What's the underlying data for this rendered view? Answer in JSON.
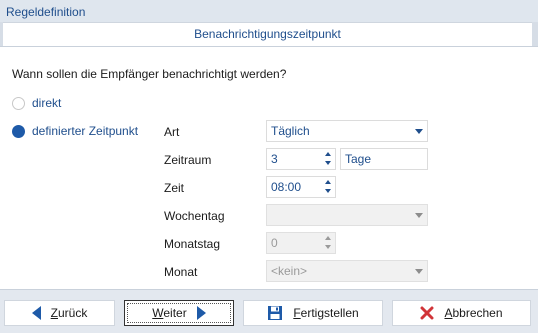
{
  "window": {
    "title": "Regeldefinition"
  },
  "tab": {
    "label": "Benachrichtigungszeitpunkt"
  },
  "question": "Wann sollen die Empfänger benachrichtigt werden?",
  "options": [
    {
      "label": "direkt",
      "checked": false
    },
    {
      "label": "definierter Zeitpunkt",
      "checked": true
    }
  ],
  "fields": {
    "art": {
      "label": "Art",
      "value": "Täglich"
    },
    "zeitraum": {
      "label": "Zeitraum",
      "value": "3",
      "unit": "Tage"
    },
    "zeit": {
      "label": "Zeit",
      "value": "08:00"
    },
    "wochentag": {
      "label": "Wochentag",
      "value": ""
    },
    "monatstag": {
      "label": "Monatstag",
      "value": "0"
    },
    "monat": {
      "label": "Monat",
      "value": "<kein>"
    }
  },
  "buttons": {
    "back": {
      "hotkey": "Z",
      "rest": "urück",
      "icon": "arrow-left-icon"
    },
    "next": {
      "hotkey": "W",
      "rest": "eiter",
      "icon": "arrow-right-icon"
    },
    "finish": {
      "hotkey": "F",
      "rest": "ertigstellen",
      "icon": "save-icon"
    },
    "cancel": {
      "hotkey": "A",
      "rest": "bbrechen",
      "icon": "close-icon"
    }
  },
  "colors": {
    "accent": "#1e5aa8",
    "text_blue": "#1f4e8c",
    "cancel_red": "#d13438"
  }
}
